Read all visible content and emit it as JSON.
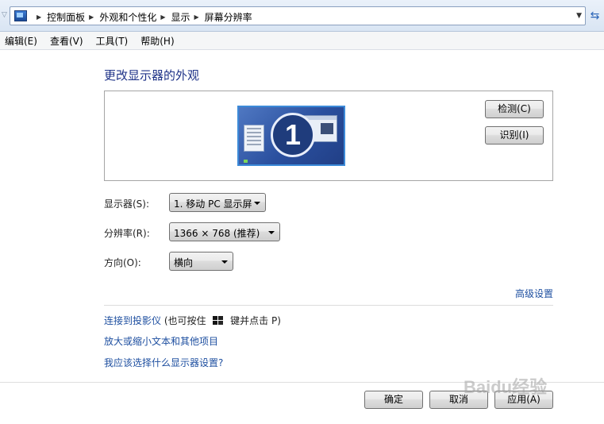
{
  "address_bar": {
    "crumbs": [
      "控制面板",
      "外观和个性化",
      "显示",
      "屏幕分辨率"
    ]
  },
  "menu": {
    "items": [
      "编辑(E)",
      "查看(V)",
      "工具(T)",
      "帮助(H)"
    ]
  },
  "main": {
    "heading": "更改显示器的外观",
    "monitor_number": "1",
    "detect_label": "检测(C)",
    "identify_label": "识别(I)",
    "display_label": "显示器(S):",
    "display_value": "1. 移动 PC 显示屏",
    "resolution_label": "分辨率(R):",
    "resolution_value": "1366 × 768 (推荐)",
    "orientation_label": "方向(O):",
    "orientation_value": "横向",
    "advanced_link": "高级设置",
    "projector_link": "连接到投影仪",
    "projector_hint_a": " (也可按住 ",
    "projector_hint_b": " 键并点击 P)",
    "text_size_link": "放大或缩小文本和其他项目",
    "which_settings_link": "我应该选择什么显示器设置?"
  },
  "footer": {
    "ok_label": "确定",
    "cancel_label": "取消",
    "apply_label": "应用(A)"
  },
  "watermark": "Baidu经验",
  "colors": {
    "heading": "#1e3287",
    "link": "#1e4fa0",
    "monitor_border": "#3c8ad8"
  },
  "icons": [
    "control-panel-icon",
    "breadcrumb-arrow-icon",
    "dropdown-arrow-icon",
    "refresh-icon",
    "windows-key-icon",
    "monitor-icon"
  ]
}
